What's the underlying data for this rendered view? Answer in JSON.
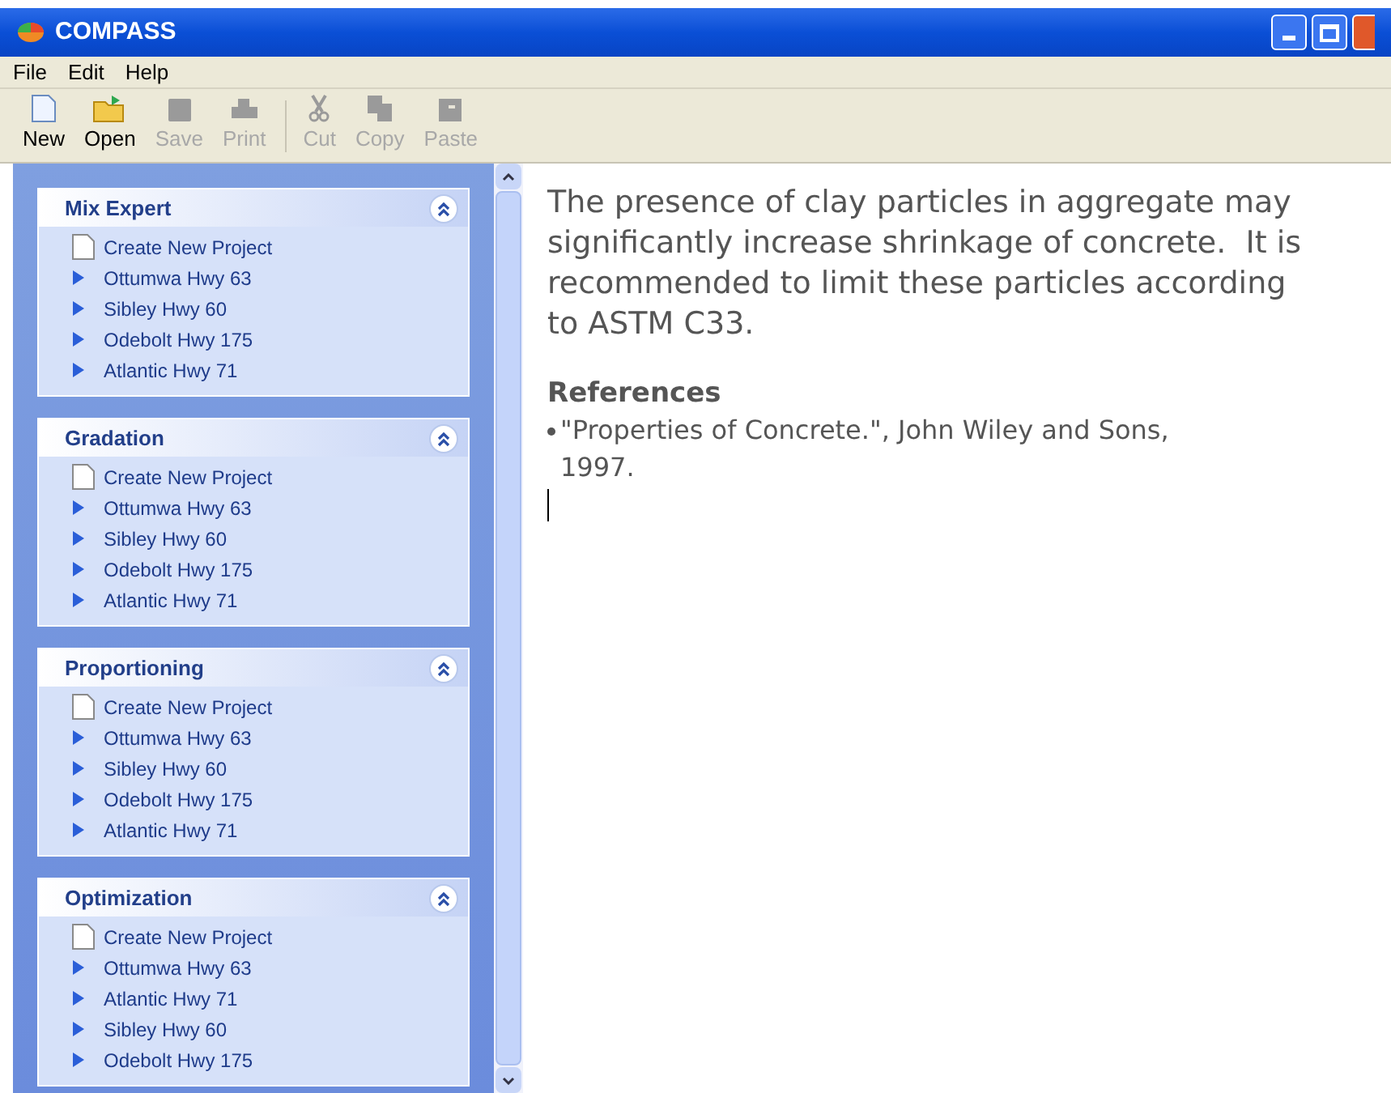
{
  "window": {
    "title": "COMPASS"
  },
  "menu": [
    "File",
    "Edit",
    "Help"
  ],
  "toolbar": [
    {
      "kind": "new",
      "label": "New",
      "disabled": false
    },
    {
      "kind": "open",
      "label": "Open",
      "disabled": false
    },
    {
      "kind": "save",
      "label": "Save",
      "disabled": true
    },
    {
      "kind": "print",
      "label": "Print",
      "disabled": true
    },
    {
      "kind": "cut",
      "label": "Cut",
      "disabled": true
    },
    {
      "kind": "copy",
      "label": "Copy",
      "disabled": true
    },
    {
      "kind": "paste",
      "label": "Paste",
      "disabled": true
    }
  ],
  "sidebar": {
    "panels": [
      {
        "title": "Mix Expert",
        "expanded": true,
        "items": [
          {
            "kind": "new",
            "label": "Create New Project"
          },
          {
            "kind": "project",
            "label": "Ottumwa Hwy 63"
          },
          {
            "kind": "project",
            "label": "Sibley Hwy 60"
          },
          {
            "kind": "project",
            "label": "Odebolt Hwy 175"
          },
          {
            "kind": "project",
            "label": "Atlantic Hwy 71"
          }
        ]
      },
      {
        "title": "Gradation",
        "expanded": true,
        "items": [
          {
            "kind": "new",
            "label": "Create New Project"
          },
          {
            "kind": "project",
            "label": "Ottumwa Hwy 63"
          },
          {
            "kind": "project",
            "label": "Sibley Hwy 60"
          },
          {
            "kind": "project",
            "label": "Odebolt Hwy 175"
          },
          {
            "kind": "project",
            "label": "Atlantic Hwy 71"
          }
        ]
      },
      {
        "title": "Proportioning",
        "expanded": true,
        "items": [
          {
            "kind": "new",
            "label": "Create New Project"
          },
          {
            "kind": "project",
            "label": "Ottumwa Hwy 63"
          },
          {
            "kind": "project",
            "label": "Sibley Hwy 60"
          },
          {
            "kind": "project",
            "label": "Odebolt Hwy 175"
          },
          {
            "kind": "project",
            "label": "Atlantic Hwy 71"
          }
        ]
      },
      {
        "title": "Optimization",
        "expanded": true,
        "items": [
          {
            "kind": "new",
            "label": "Create New Project"
          },
          {
            "kind": "project",
            "label": "Ottumwa Hwy 63"
          },
          {
            "kind": "project",
            "label": "Atlantic Hwy 71"
          },
          {
            "kind": "project",
            "label": "Sibley Hwy 60"
          },
          {
            "kind": "project",
            "label": "Odebolt Hwy 175"
          }
        ]
      }
    ]
  },
  "document": {
    "paragraph": "The presence of clay particles in aggregate may significantly increase shrinkage of concrete.  It is recommended to limit these particles according to ASTM C33.",
    "references_heading": "References",
    "references": [
      "\"Properties of Concrete.\", John Wiley and Sons, 1997."
    ]
  }
}
